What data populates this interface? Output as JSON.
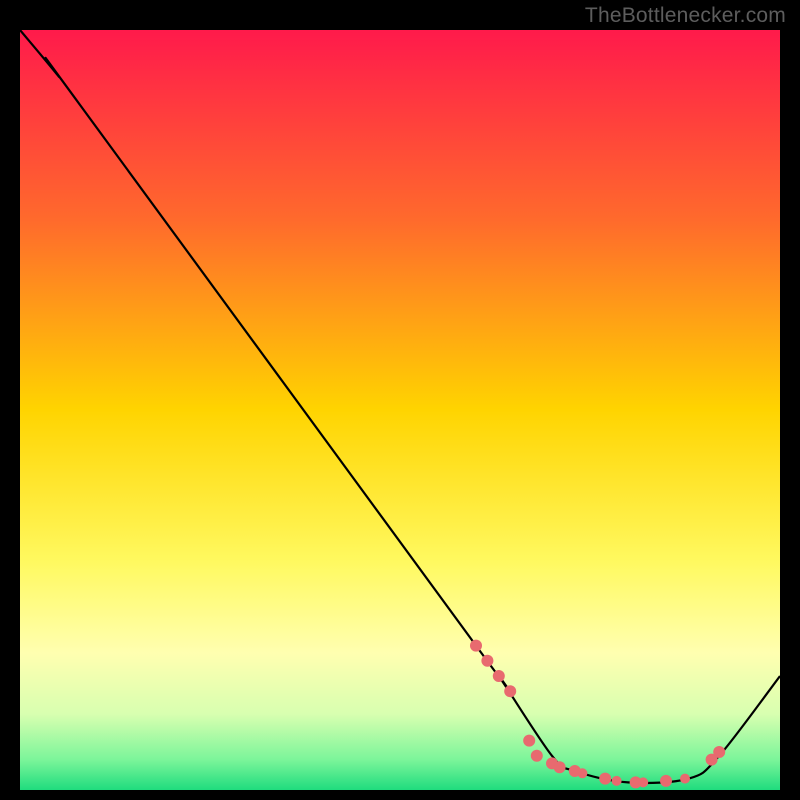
{
  "attribution": "TheBottlenecker.com",
  "chart_data": {
    "type": "line",
    "title": "",
    "xlabel": "",
    "ylabel": "",
    "xlim": [
      0,
      100
    ],
    "ylim": [
      0,
      100
    ],
    "background_gradient": [
      {
        "offset": 0,
        "color": "#ff1a4b"
      },
      {
        "offset": 0.25,
        "color": "#ff6a2c"
      },
      {
        "offset": 0.5,
        "color": "#ffd400"
      },
      {
        "offset": 0.7,
        "color": "#fff960"
      },
      {
        "offset": 0.82,
        "color": "#ffffb0"
      },
      {
        "offset": 0.9,
        "color": "#d8ffb0"
      },
      {
        "offset": 0.96,
        "color": "#7cf59a"
      },
      {
        "offset": 1.0,
        "color": "#1fdc7e"
      }
    ],
    "series": [
      {
        "name": "bottleneck-curve",
        "color": "#000000",
        "points": [
          {
            "x": 0,
            "y": 100
          },
          {
            "x": 5,
            "y": 94
          },
          {
            "x": 8,
            "y": 90
          },
          {
            "x": 60,
            "y": 19
          },
          {
            "x": 63,
            "y": 15
          },
          {
            "x": 70,
            "y": 4.5
          },
          {
            "x": 73,
            "y": 2.5
          },
          {
            "x": 80,
            "y": 1.0
          },
          {
            "x": 88,
            "y": 1.5
          },
          {
            "x": 92,
            "y": 4.5
          },
          {
            "x": 100,
            "y": 15
          }
        ]
      }
    ],
    "markers": {
      "color": "#e86a6f",
      "radius_base": 6,
      "points": [
        {
          "x": 60,
          "y": 19,
          "r": 6
        },
        {
          "x": 61.5,
          "y": 17,
          "r": 6
        },
        {
          "x": 63,
          "y": 15,
          "r": 6
        },
        {
          "x": 64.5,
          "y": 13,
          "r": 6
        },
        {
          "x": 67,
          "y": 6.5,
          "r": 6
        },
        {
          "x": 68,
          "y": 4.5,
          "r": 6
        },
        {
          "x": 70,
          "y": 3.5,
          "r": 6
        },
        {
          "x": 71,
          "y": 3.0,
          "r": 6
        },
        {
          "x": 73,
          "y": 2.5,
          "r": 6
        },
        {
          "x": 74,
          "y": 2.2,
          "r": 5
        },
        {
          "x": 77,
          "y": 1.5,
          "r": 6
        },
        {
          "x": 78.5,
          "y": 1.2,
          "r": 5
        },
        {
          "x": 81,
          "y": 1.0,
          "r": 6
        },
        {
          "x": 82,
          "y": 1.0,
          "r": 5
        },
        {
          "x": 85,
          "y": 1.2,
          "r": 6
        },
        {
          "x": 87.5,
          "y": 1.5,
          "r": 5
        },
        {
          "x": 91,
          "y": 4.0,
          "r": 6
        },
        {
          "x": 92,
          "y": 5.0,
          "r": 6
        }
      ]
    }
  }
}
